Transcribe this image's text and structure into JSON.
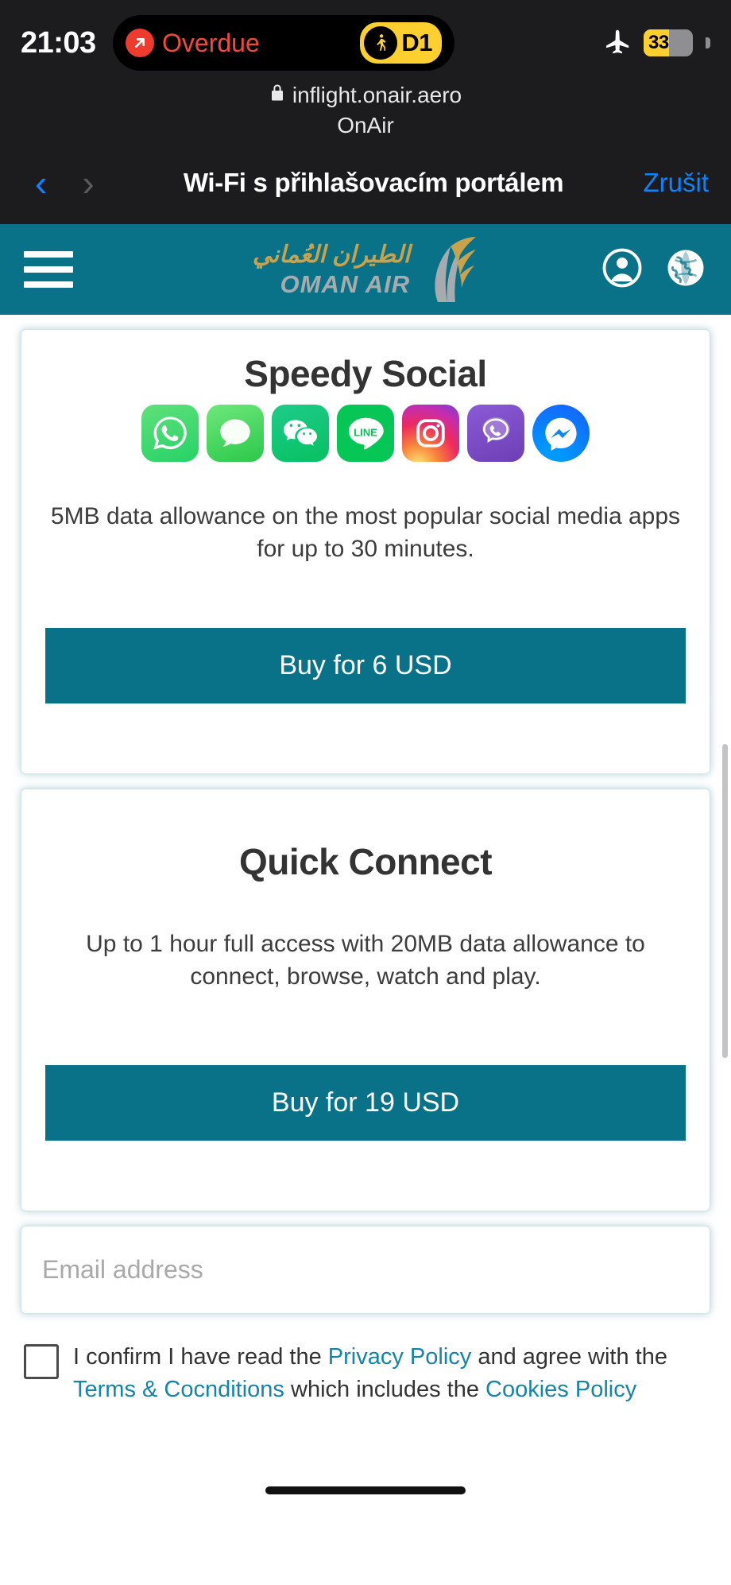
{
  "status_bar": {
    "time": "21:03",
    "dynamic_island": {
      "alert_label": "Overdue",
      "alert_icon": "arrow-up-right-icon",
      "gate_icon": "walking-person-icon",
      "gate_label": "D1"
    },
    "airplane_mode_icon": "airplane-icon",
    "battery_percent": "33"
  },
  "browser": {
    "lock_icon": "lock-icon",
    "url": "inflight.onair.aero",
    "app_name": "OnAir",
    "back_icon": "chevron-left-icon",
    "forward_icon": "chevron-right-icon",
    "title": "Wi-Fi s přihlašovacím portálem",
    "cancel_label": "Zrušit"
  },
  "brand_header": {
    "menu_icon": "hamburger-menu-icon",
    "logo_arabic": "الطيران العُماني",
    "logo_latin": "OMAN AIR",
    "logo_mark_icon": "oman-air-feather-icon",
    "account_icon": "user-account-icon",
    "language_icon": "globe-language-icon",
    "background_color": "#0a7288"
  },
  "plans": [
    {
      "id": "speedy-social",
      "title": "Speedy Social",
      "description": "5MB data allowance on the most popular social media apps for up to 30 minutes.",
      "buy_label": "Buy for 6 USD",
      "apps": [
        {
          "name": "whatsapp-icon",
          "css": "ic-whatsapp"
        },
        {
          "name": "imessage-icon",
          "css": "ic-imessage"
        },
        {
          "name": "wechat-icon",
          "css": "ic-wechat"
        },
        {
          "name": "line-icon",
          "css": "ic-line"
        },
        {
          "name": "instagram-icon",
          "css": "ic-instagram"
        },
        {
          "name": "viber-icon",
          "css": "ic-viber"
        },
        {
          "name": "messenger-icon",
          "css": "ic-messenger"
        }
      ]
    },
    {
      "id": "quick-connect",
      "title": "Quick Connect",
      "description": "Up to 1 hour full access with 20MB data allowance to connect, browse, watch and play.",
      "buy_label": "Buy for 19 USD"
    }
  ],
  "form": {
    "email_placeholder": "Email address",
    "email_value": "",
    "consent": {
      "checked": false,
      "part1": "I confirm I have read the ",
      "link_privacy": "Privacy Policy",
      "part2": " and agree with the ",
      "link_terms": "Terms & Cocnditions",
      "part3": " which includes the ",
      "link_cookies": "Cookies Policy"
    }
  },
  "colors": {
    "brand_teal": "#0a7288",
    "link_blue": "#1484a8",
    "ios_blue": "#0a84ff",
    "alert_red": "#f2493c",
    "accent_yellow": "#fdcf2f"
  }
}
